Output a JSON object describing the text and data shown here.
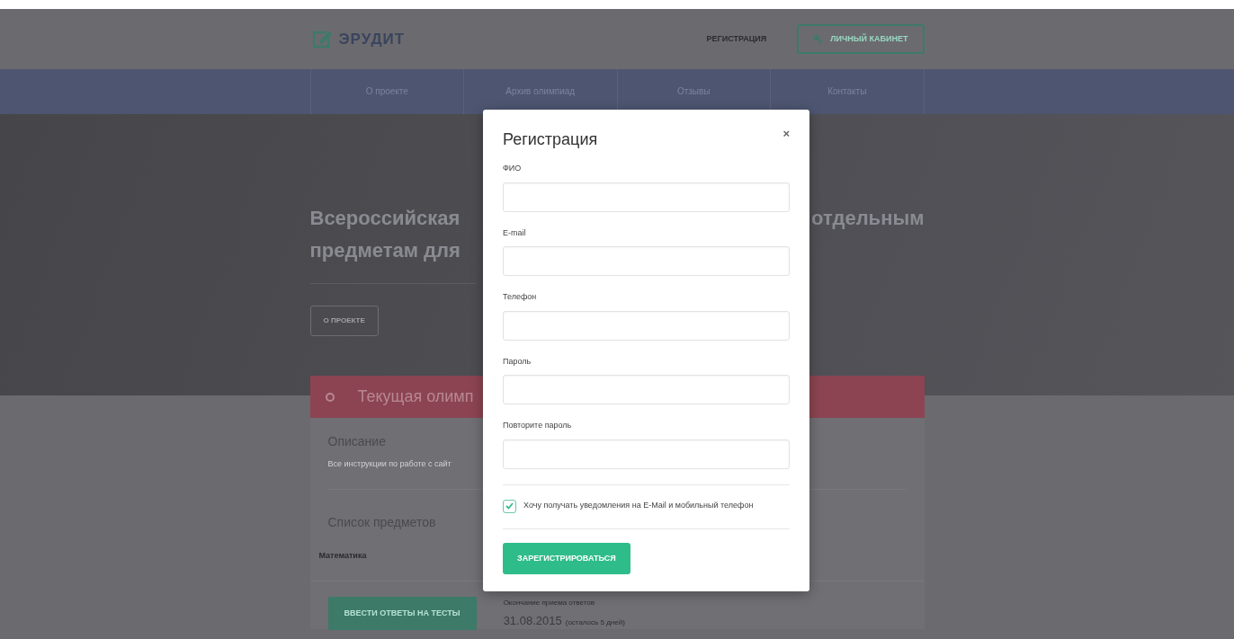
{
  "header": {
    "logo": "ЭРУДИТ",
    "links": [
      {
        "kind": "link",
        "label": "РЕГИСТРАЦИЯ"
      },
      {
        "kind": "button",
        "label": "ЛИЧНЫЙ КАБИНЕТ"
      }
    ]
  },
  "nav": {
    "items": [
      "О проекте",
      "Архив олимпиад",
      "Отзывы",
      "Контакты"
    ]
  },
  "hero": {
    "title_lines": [
      {
        "left": "Всероссийская",
        "right": "отдельным"
      },
      {
        "left": "предметам для"
      }
    ],
    "button": "О ПРОЕКТЕ"
  },
  "olympiad": {
    "title": "Текущая олимп",
    "description_heading": "Описание",
    "description": "Все инструкции по работе с сайт",
    "subjects_heading": "Список предметов",
    "subjects": [
      "Математика"
    ],
    "action": "ВВЕСТИ ОТВЕТЫ НА ТЕСТЫ",
    "deadline_label": "Окончание приема ответов",
    "deadline_date": "31.08.2015",
    "deadline_note": "(осталось 5 дней)"
  },
  "modal": {
    "title": "Регистрация",
    "close": "×",
    "fields": [
      {
        "label": "ФИО"
      },
      {
        "label": "E-mail"
      },
      {
        "label": "Телефон"
      },
      {
        "label": "Пароль"
      },
      {
        "label": "Повторите пароль"
      }
    ],
    "consent": {
      "label": "Хочу получать уведомления на E-Mail и мобильный телефон",
      "checked": true
    },
    "submit": "ЗАРЕГИСТРИРОВАТЬСЯ"
  }
}
